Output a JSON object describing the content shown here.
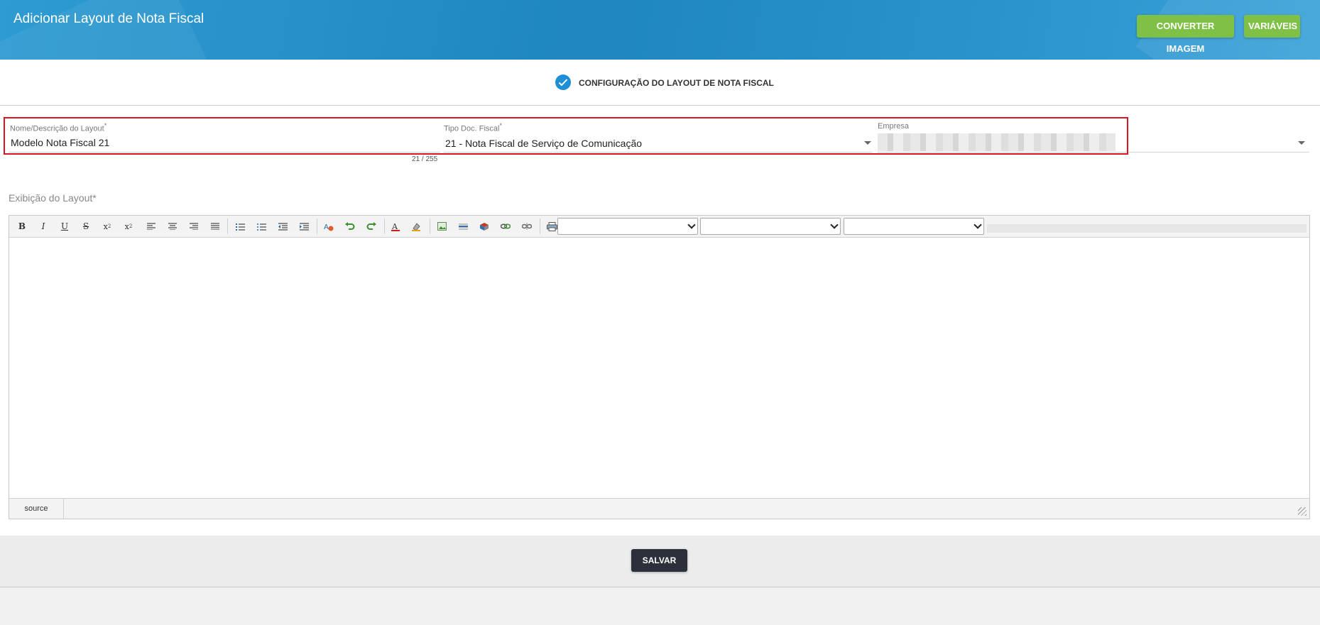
{
  "header": {
    "title": "Adicionar Layout de Nota Fiscal",
    "convert_label": "CONVERTER IMAGEM",
    "variables_label": "VARIÁVEIS"
  },
  "step": {
    "label": "CONFIGURAÇÃO DO LAYOUT DE NOTA FISCAL"
  },
  "form": {
    "name_label": "Nome/Descrição do Layout",
    "name_value": "Modelo Nota Fiscal 21",
    "name_counter": "21 / 255",
    "tipo_label": "Tipo Doc. Fiscal",
    "tipo_value": "21 - Nota Fiscal de Serviço de Comunicação",
    "empresa_label": "Empresa",
    "required_mark": "*"
  },
  "editor": {
    "label": "Exibição do Layout*",
    "source_label": "source",
    "toolbar_icons": [
      "bold-icon",
      "italic-icon",
      "underline-icon",
      "strikethrough-icon",
      "subscript-icon",
      "superscript-icon",
      "align-left-icon",
      "align-center-icon",
      "align-right-icon",
      "align-justify-icon",
      "ordered-list-icon",
      "unordered-list-icon",
      "outdent-icon",
      "indent-icon",
      "remove-format-icon",
      "undo-icon",
      "redo-icon",
      "font-color-icon",
      "highlight-color-icon",
      "image-icon",
      "horizontal-rule-icon",
      "table-icon",
      "link-icon",
      "unlink-icon",
      "print-icon"
    ]
  },
  "footer": {
    "save_label": "SALVAR"
  },
  "colors": {
    "header": "#1f86bf",
    "accent_green": "#7ec146",
    "check_blue": "#1e8fd6",
    "highlight_red": "#e0141e",
    "save_dark": "#2b303b"
  }
}
